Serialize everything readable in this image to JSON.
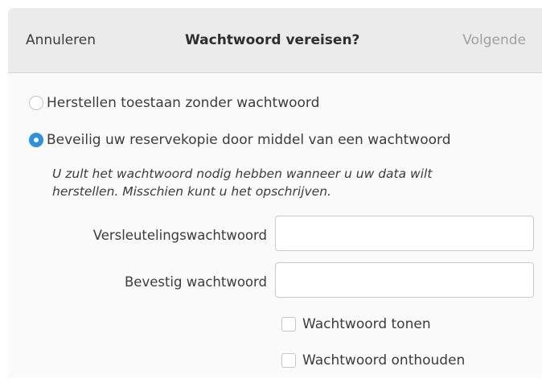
{
  "header": {
    "cancel_label": "Annuleren",
    "title": "Wachtwoord vereisen?",
    "next_label": "Volgende"
  },
  "options": {
    "no_password_label": "Herstellen toestaan zonder wachtwoord",
    "no_password_selected": false,
    "with_password_label": "Beveilig uw reservekopie door middel van een wachtwoord",
    "with_password_selected": true
  },
  "hint": {
    "line1": "U zult het wachtwoord nodig hebben wanneer u uw data wilt",
    "line2": "herstellen. Misschien kunt u het opschrijven."
  },
  "fields": {
    "encryption_label": "Versleutelingswachtwoord",
    "encryption_value": "",
    "confirm_label": "Bevestig wachtwoord",
    "confirm_value": ""
  },
  "checkboxes": {
    "show_password_label": "Wachtwoord tonen",
    "show_password_checked": false,
    "remember_password_label": "Wachtwoord onthouden",
    "remember_password_checked": false
  },
  "colors": {
    "accent": "#2f8fe0",
    "headerbar": "#ebebeb",
    "disabled_text": "#a0a0a0"
  }
}
